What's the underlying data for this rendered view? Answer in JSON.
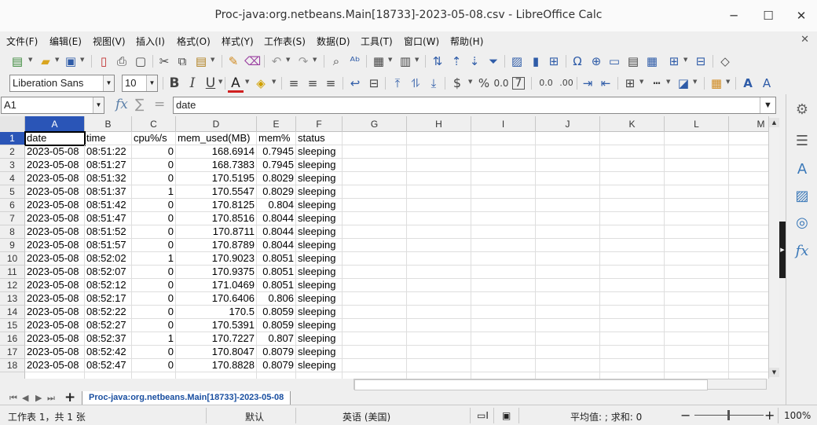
{
  "window": {
    "title": "Proc-java:org.netbeans.Main[18733]-2023-05-08.csv - LibreOffice Calc",
    "minimize": "─",
    "maximize": "☐",
    "close": "✕"
  },
  "menu": [
    "文件(F)",
    "编辑(E)",
    "视图(V)",
    "插入(I)",
    "格式(O)",
    "样式(Y)",
    "工作表(S)",
    "数据(D)",
    "工具(T)",
    "窗口(W)",
    "帮助(H)"
  ],
  "doc_close": "✕",
  "toolbar": {
    "font_name": "Liberation Sans",
    "font_size": "10",
    "bold": "B",
    "italic": "I",
    "underline": "U",
    "font_color": "A",
    "currency": "$",
    "percent": "%",
    "number": "0.0",
    "decimals": "7",
    "decimals_add": "0.0",
    "decimals_remove": ".00"
  },
  "formula_bar": {
    "name_box": "A1",
    "fx": "fx",
    "sum": "∑",
    "equals": "=",
    "content": "date"
  },
  "columns": [
    "A",
    "B",
    "C",
    "D",
    "E",
    "F",
    "G",
    "H",
    "I",
    "J",
    "K",
    "L",
    "M"
  ],
  "rows": [
    {
      "n": "1",
      "cells": [
        "date",
        "time",
        "cpu%/s",
        "mem_used(MB)",
        "mem%",
        "status"
      ]
    },
    {
      "n": "2",
      "cells": [
        "2023-05-08",
        "08:51:22",
        "0",
        "168.6914",
        "0.7945",
        "sleeping"
      ]
    },
    {
      "n": "3",
      "cells": [
        "2023-05-08",
        "08:51:27",
        "0",
        "168.7383",
        "0.7945",
        "sleeping"
      ]
    },
    {
      "n": "4",
      "cells": [
        "2023-05-08",
        "08:51:32",
        "0",
        "170.5195",
        "0.8029",
        "sleeping"
      ]
    },
    {
      "n": "5",
      "cells": [
        "2023-05-08",
        "08:51:37",
        "1",
        "170.5547",
        "0.8029",
        "sleeping"
      ]
    },
    {
      "n": "6",
      "cells": [
        "2023-05-08",
        "08:51:42",
        "0",
        "170.8125",
        "0.804",
        "sleeping"
      ]
    },
    {
      "n": "7",
      "cells": [
        "2023-05-08",
        "08:51:47",
        "0",
        "170.8516",
        "0.8044",
        "sleeping"
      ]
    },
    {
      "n": "8",
      "cells": [
        "2023-05-08",
        "08:51:52",
        "0",
        "170.8711",
        "0.8044",
        "sleeping"
      ]
    },
    {
      "n": "9",
      "cells": [
        "2023-05-08",
        "08:51:57",
        "0",
        "170.8789",
        "0.8044",
        "sleeping"
      ]
    },
    {
      "n": "10",
      "cells": [
        "2023-05-08",
        "08:52:02",
        "1",
        "170.9023",
        "0.8051",
        "sleeping"
      ]
    },
    {
      "n": "11",
      "cells": [
        "2023-05-08",
        "08:52:07",
        "0",
        "170.9375",
        "0.8051",
        "sleeping"
      ]
    },
    {
      "n": "12",
      "cells": [
        "2023-05-08",
        "08:52:12",
        "0",
        "171.0469",
        "0.8051",
        "sleeping"
      ]
    },
    {
      "n": "13",
      "cells": [
        "2023-05-08",
        "08:52:17",
        "0",
        "170.6406",
        "0.806",
        "sleeping"
      ]
    },
    {
      "n": "14",
      "cells": [
        "2023-05-08",
        "08:52:22",
        "0",
        "170.5",
        "0.8059",
        "sleeping"
      ]
    },
    {
      "n": "15",
      "cells": [
        "2023-05-08",
        "08:52:27",
        "0",
        "170.5391",
        "0.8059",
        "sleeping"
      ]
    },
    {
      "n": "16",
      "cells": [
        "2023-05-08",
        "08:52:37",
        "1",
        "170.7227",
        "0.807",
        "sleeping"
      ]
    },
    {
      "n": "17",
      "cells": [
        "2023-05-08",
        "08:52:42",
        "0",
        "170.8047",
        "0.8079",
        "sleeping"
      ]
    },
    {
      "n": "18",
      "cells": [
        "2023-05-08",
        "08:52:47",
        "0",
        "170.8828",
        "0.8079",
        "sleeping"
      ]
    }
  ],
  "sheet_tab": "Proc-java:org.netbeans.Main[18733]-2023-05-08",
  "add_sheet": "+",
  "status": {
    "sheet_info": "工作表 1，共 1 张",
    "page_style": "默认",
    "language": "英语 (美国)",
    "summary": "平均值: ; 求和: 0",
    "zoom": "100%",
    "zoom_minus": "−",
    "zoom_plus": "+"
  },
  "colors": {
    "selection": "#2a55b7",
    "sidebar_icon": "#3a78b8"
  }
}
